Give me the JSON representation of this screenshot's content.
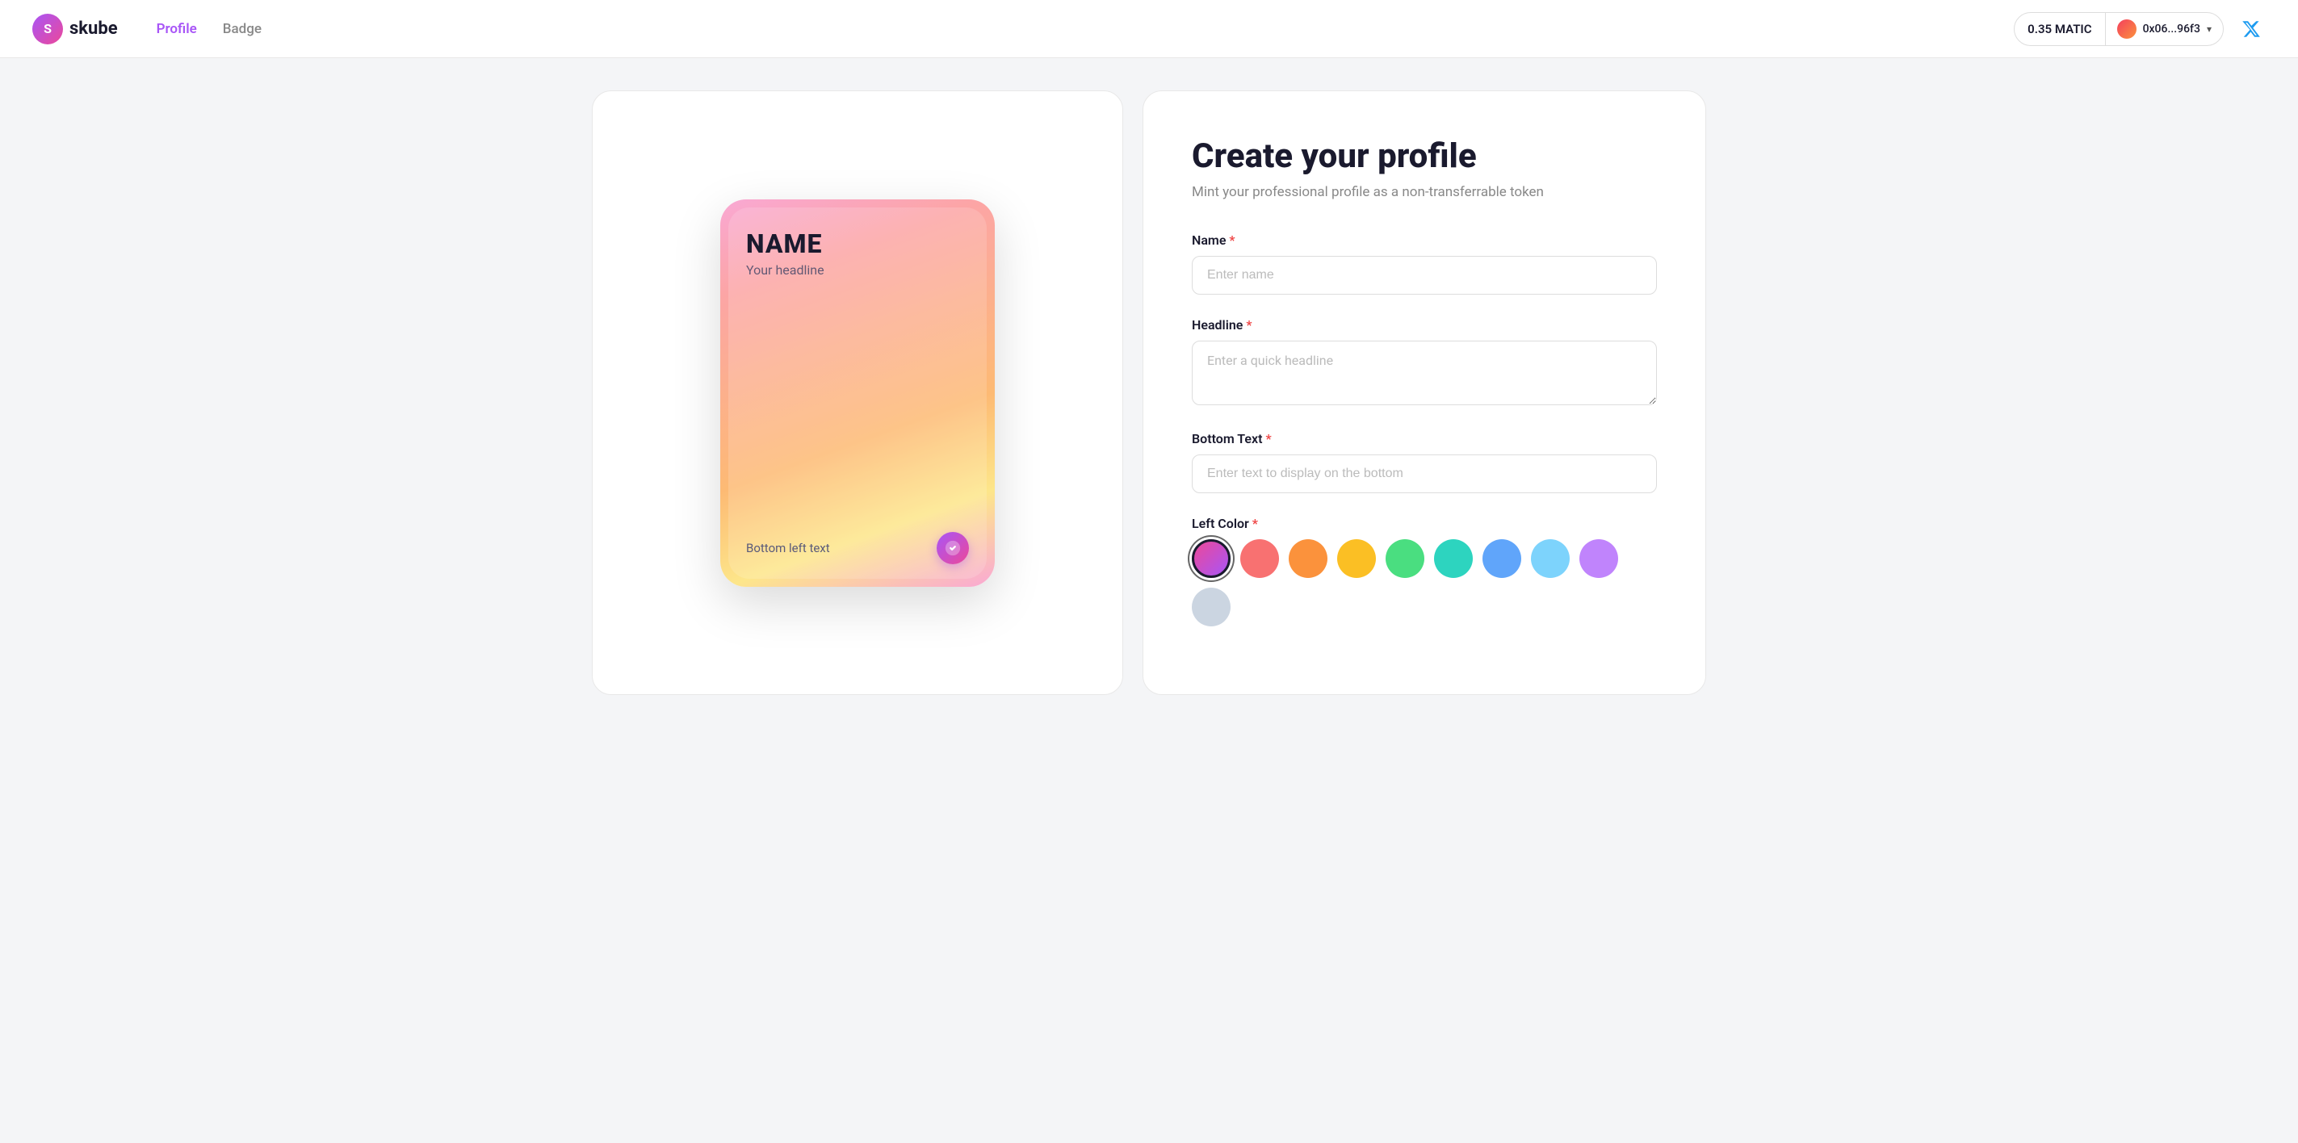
{
  "app": {
    "name": "skube",
    "logo_text": "skube"
  },
  "navbar": {
    "profile_label": "Profile",
    "badge_label": "Badge",
    "wallet_balance": "0.35 MATIC",
    "wallet_address": "0x06...96f3",
    "twitter_title": "Twitter"
  },
  "card_preview": {
    "name": "NAME",
    "headline": "Your headline",
    "bottom_text": "Bottom left text"
  },
  "form": {
    "title": "Create your profile",
    "subtitle": "Mint your professional profile as a non-transferrable token",
    "name_label": "Name",
    "name_placeholder": "Enter name",
    "headline_label": "Headline",
    "headline_placeholder": "Enter a quick headline",
    "bottom_text_label": "Bottom Text",
    "bottom_text_placeholder": "Enter text to display on the bottom",
    "left_color_label": "Left Color",
    "required_marker": "*",
    "colors": [
      {
        "id": "pink",
        "class": "color-swatch-pink",
        "label": "Pink-Purple"
      },
      {
        "id": "coral",
        "class": "color-swatch-coral",
        "label": "Coral"
      },
      {
        "id": "orange",
        "class": "color-swatch-orange",
        "label": "Orange"
      },
      {
        "id": "yellow",
        "class": "color-swatch-yellow",
        "label": "Yellow"
      },
      {
        "id": "green",
        "class": "color-swatch-green",
        "label": "Green"
      },
      {
        "id": "teal",
        "class": "color-swatch-teal",
        "label": "Teal"
      },
      {
        "id": "blue",
        "class": "color-swatch-blue",
        "label": "Blue"
      },
      {
        "id": "sky",
        "class": "color-swatch-sky",
        "label": "Sky"
      },
      {
        "id": "purple",
        "class": "color-swatch-purple",
        "label": "Purple"
      },
      {
        "id": "gray",
        "class": "color-swatch-gray",
        "label": "Gray"
      }
    ]
  }
}
